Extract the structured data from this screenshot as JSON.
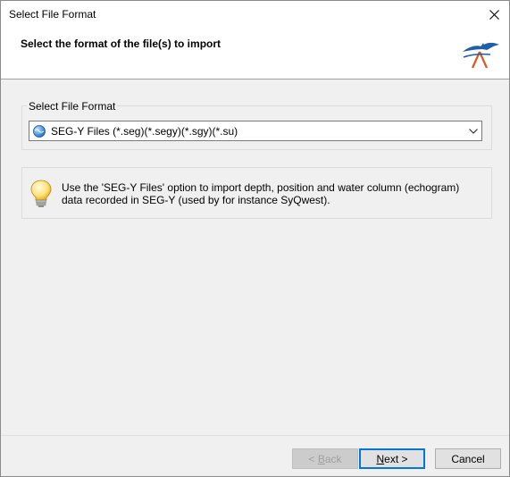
{
  "window": {
    "title": "Select File Format",
    "close_icon": "close-icon"
  },
  "header": {
    "title": "Select the format of the file(s) to import",
    "logo_icon": "brand-logo"
  },
  "format_group": {
    "label": "Select File Format",
    "selected": "SEG-Y Files (*.seg)(*.segy)(*.sgy)(*.su)",
    "item_icon": "globe-icon",
    "arrow_icon": "chevron-down-icon"
  },
  "info": {
    "icon": "lightbulb-icon",
    "text": "Use the 'SEG-Y Files' option to import depth, position and water column (echogram) data recorded in SEG-Y (used by for instance SyQwest)."
  },
  "buttons": {
    "back_prefix": "< ",
    "back_key": "B",
    "back_rest": "ack",
    "next_key": "N",
    "next_rest": "ext >",
    "cancel": "Cancel"
  },
  "colors": {
    "accent": "#0078d7",
    "logo_blue": "#1f5fa6",
    "logo_orange": "#d65a1f"
  }
}
